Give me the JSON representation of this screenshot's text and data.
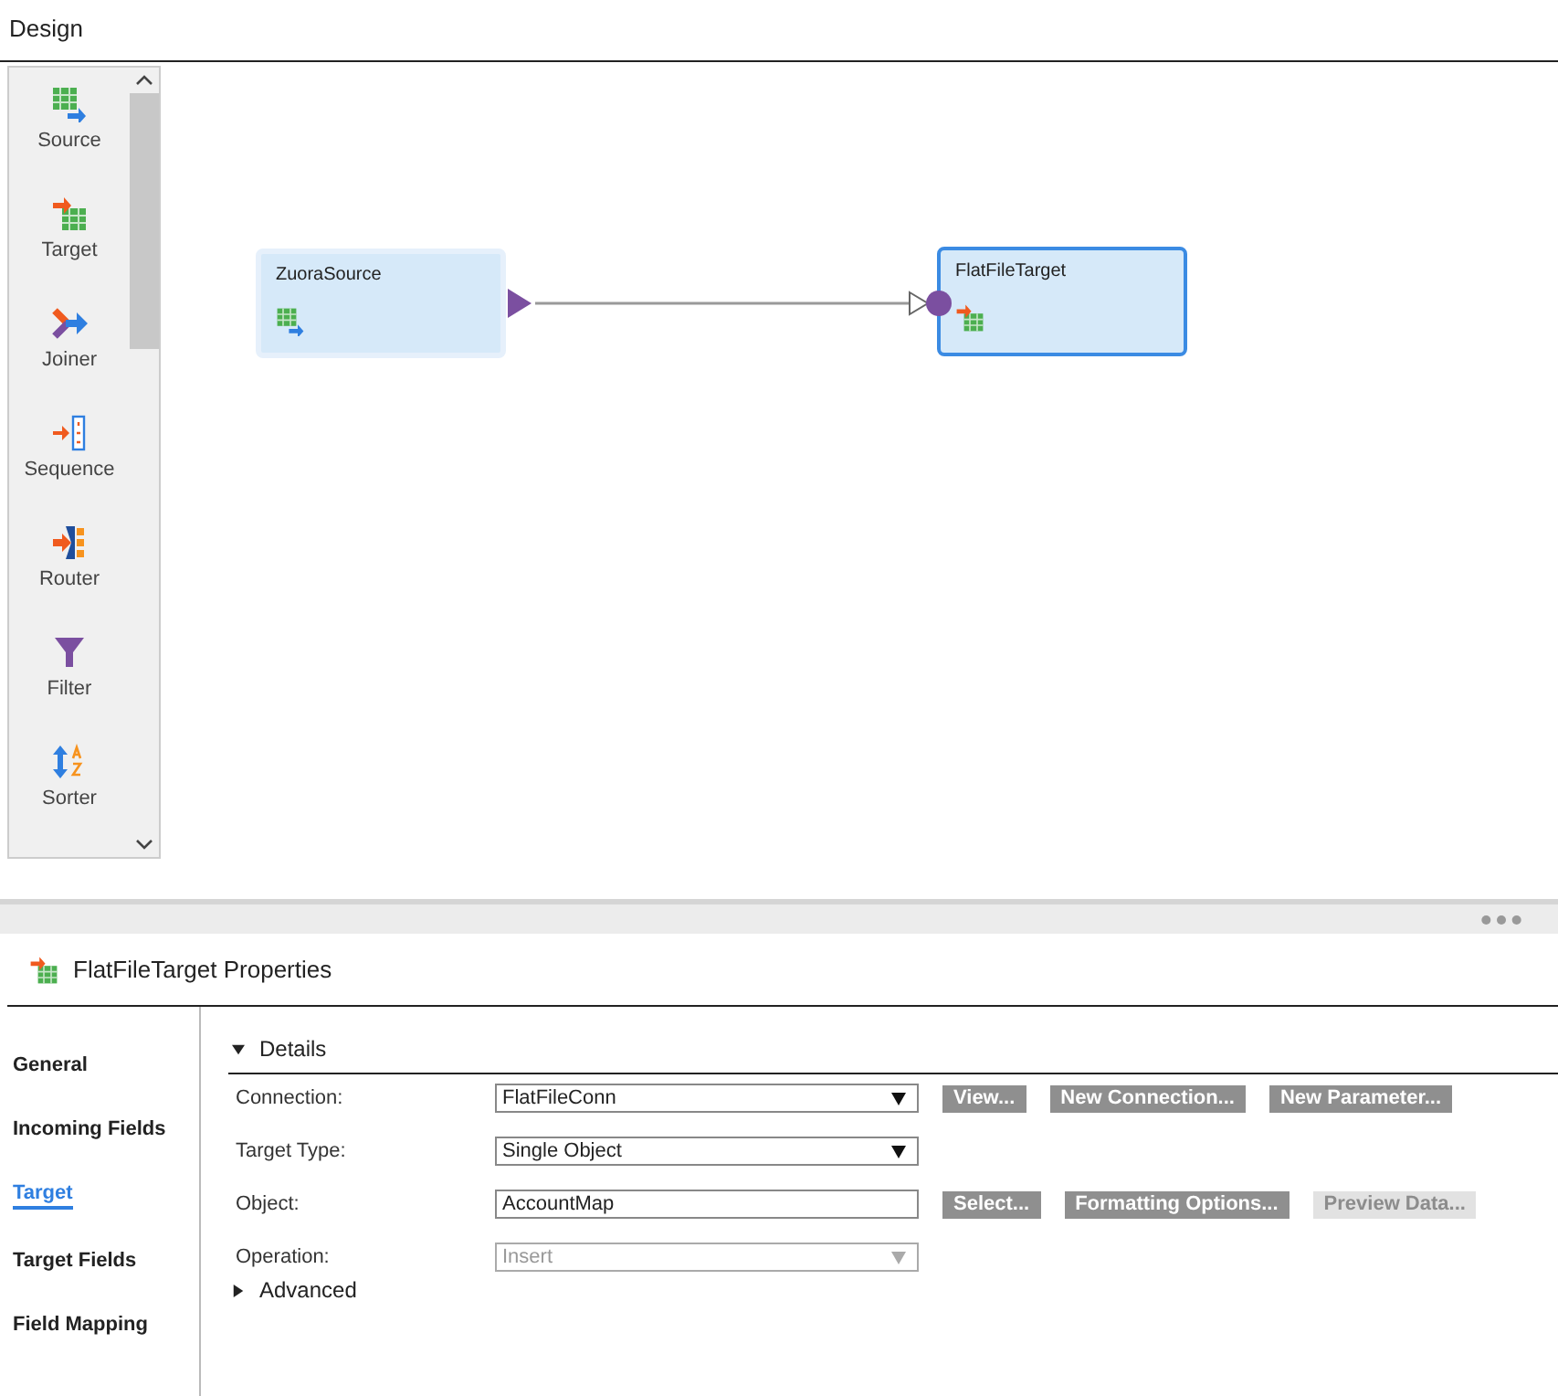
{
  "title": "Design",
  "palette": {
    "items": [
      {
        "label": "Source",
        "kind": "source"
      },
      {
        "label": "Target",
        "kind": "target"
      },
      {
        "label": "Joiner",
        "kind": "joiner"
      },
      {
        "label": "Sequence",
        "kind": "sequence"
      },
      {
        "label": "Router",
        "kind": "router"
      },
      {
        "label": "Filter",
        "kind": "filter"
      },
      {
        "label": "Sorter",
        "kind": "sorter"
      }
    ]
  },
  "canvas": {
    "nodes": [
      {
        "label": "ZuoraSource",
        "kind": "source",
        "selected": false
      },
      {
        "label": "FlatFileTarget",
        "kind": "target",
        "selected": true
      }
    ]
  },
  "properties": {
    "title": "FlatFileTarget Properties",
    "tabs": [
      {
        "label": "General",
        "selected": false
      },
      {
        "label": "Incoming Fields",
        "selected": false
      },
      {
        "label": "Target",
        "selected": true
      },
      {
        "label": "Target Fields",
        "selected": false
      },
      {
        "label": "Field Mapping",
        "selected": false
      }
    ],
    "details": {
      "label": "Details",
      "expanded": true
    },
    "fields": [
      {
        "label": "Connection:",
        "kind": "select",
        "value": "FlatFileConn",
        "disabled": false,
        "buttons": [
          {
            "label": "View...",
            "disabled": false
          },
          {
            "label": "New Connection...",
            "disabled": false
          },
          {
            "label": "New Parameter...",
            "disabled": false
          }
        ]
      },
      {
        "label": "Target Type:",
        "kind": "select",
        "value": "Single Object",
        "disabled": false
      },
      {
        "label": "Object:",
        "kind": "text",
        "value": "AccountMap",
        "disabled": false,
        "buttons": [
          {
            "label": "Select...",
            "disabled": false
          },
          {
            "label": "Formatting Options...",
            "disabled": false
          },
          {
            "label": "Preview Data...",
            "disabled": true
          }
        ]
      },
      {
        "label": "Operation:",
        "kind": "select",
        "value": "Insert",
        "disabled": true
      }
    ],
    "advanced": {
      "label": "Advanced",
      "expanded": false
    }
  }
}
